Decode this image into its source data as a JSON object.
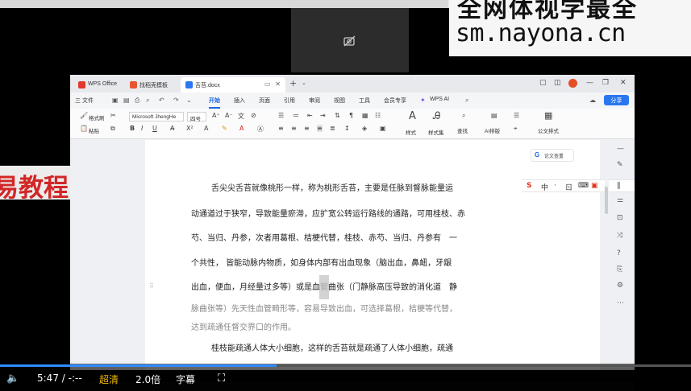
{
  "watermark": {
    "line1": "全网体视学最全",
    "line2": "sm.nayona.cn"
  },
  "banner": {
    "text": "易教程"
  },
  "camera": {
    "icon": "camera-off-icon"
  },
  "wps": {
    "tabs": [
      {
        "label": "WPS Office",
        "icon_color": "#e03a2f"
      },
      {
        "label": "找稻壳模板",
        "icon_color": "#e8542f"
      },
      {
        "label": "舌苔.docx",
        "icon_color": "#2a76f0"
      }
    ],
    "menu": {
      "file": "三 文件",
      "items": [
        "开始",
        "插入",
        "页面",
        "引用",
        "审阅",
        "视图",
        "工具",
        "会员专享"
      ],
      "active": "开始",
      "wps_ai": "WPS AI",
      "share": "分享"
    },
    "ribbon": {
      "format_painter": "格式刷",
      "paste": "粘贴",
      "font_name": "Microsoft JhengHe",
      "font_size": "四号",
      "styles": "样式",
      "style_set": "样式集",
      "find": "查找",
      "ai_layout": "AI排版",
      "official": "公文排式"
    },
    "side_panel": {
      "bookmark": "论文查重"
    },
    "ime": [
      "S",
      "中",
      "·",
      "ㄖ",
      "⌨",
      "▣",
      "♪",
      "∥"
    ]
  },
  "document": {
    "lines": [
      "舌尖尖舌苔就像桃形一样，称为桃形舌苔，主要是任脉到督脉能量运",
      "动通道过于狭窄，导致能量瘀滞，应扩宽公转运行路线的通路，可用桂枝、赤",
      "芍、当归、丹参，次者用葛根、桔梗代替，桂枝、赤芍、当归、丹参有　一",
      "个共性，  皆能动脉内物质，如身体内部有出血现象（脑出血，鼻衄，牙龈",
      "出血，便血，月经量过多等）或是血管曲张（门静脉高压导致的消化道　静",
      "脉曲张等）先天性血管畸形等，容易导致出血，可选择葛根，桔梗等代替，",
      "达到疏通任督交界口的作用。",
      "桂枝能疏通人体大小细胞，这样的舌苔就是疏通了人体小细胞，疏通"
    ]
  },
  "player": {
    "current_time": "5:47",
    "separator": "/",
    "duration": "-:--",
    "quality": "超清",
    "speed": "2.0倍",
    "subtitle": "字幕",
    "progress": 0.4
  }
}
